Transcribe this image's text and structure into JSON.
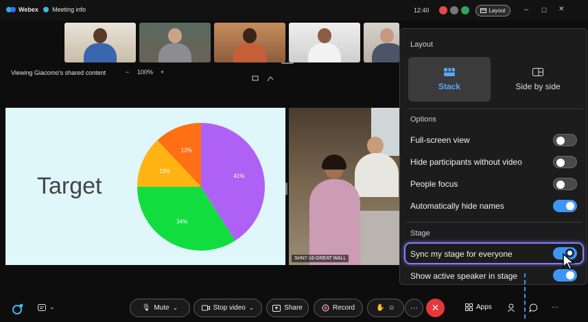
{
  "titlebar": {
    "app_name": "Webex",
    "meeting_info": "Meeting info",
    "time": "12:40",
    "layout_label": "Layout",
    "window_controls": [
      "–",
      "☐",
      "✕"
    ]
  },
  "share": {
    "text": "Viewing Giacomo's shared content",
    "zoom_out": "−",
    "zoom_level": "100%",
    "zoom_in": "+"
  },
  "slide": {
    "title": "Target",
    "chart_data": {
      "type": "pie",
      "values": [
        41,
        34,
        13,
        12
      ],
      "labels": [
        "41%",
        "34%",
        "13%",
        "12%"
      ],
      "colors": [
        "#b061f5",
        "#12dd3f",
        "#ffb414",
        "#ff7014"
      ]
    }
  },
  "video": {
    "room_label": "SHN7-16-GREAT WALL"
  },
  "layout_panel": {
    "heading": "Layout",
    "modes": [
      {
        "label": "Stack",
        "selected": true
      },
      {
        "label": "Side by side",
        "selected": false
      }
    ],
    "options_heading": "Options",
    "options": [
      {
        "label": "Full-screen view",
        "on": false
      },
      {
        "label": "Hide participants without video",
        "on": false
      },
      {
        "label": "People focus",
        "on": false
      },
      {
        "label": "Automatically hide names",
        "on": true
      }
    ],
    "stage_heading": "Stage",
    "stage_options": [
      {
        "label": "Sync my stage for everyone",
        "on": true
      },
      {
        "label": "Show active speaker in stage",
        "on": true
      }
    ]
  },
  "toolbar": {
    "mute": "Mute",
    "stop_video": "Stop video",
    "share": "Share",
    "record": "Record",
    "more": "···",
    "apps": "Apps",
    "overflow": "···"
  },
  "colors": {
    "accent": "#3d96f5",
    "end_call": "#e5383b",
    "highlight": "#8f7cf0",
    "stack_icon": "#57a7ff"
  }
}
